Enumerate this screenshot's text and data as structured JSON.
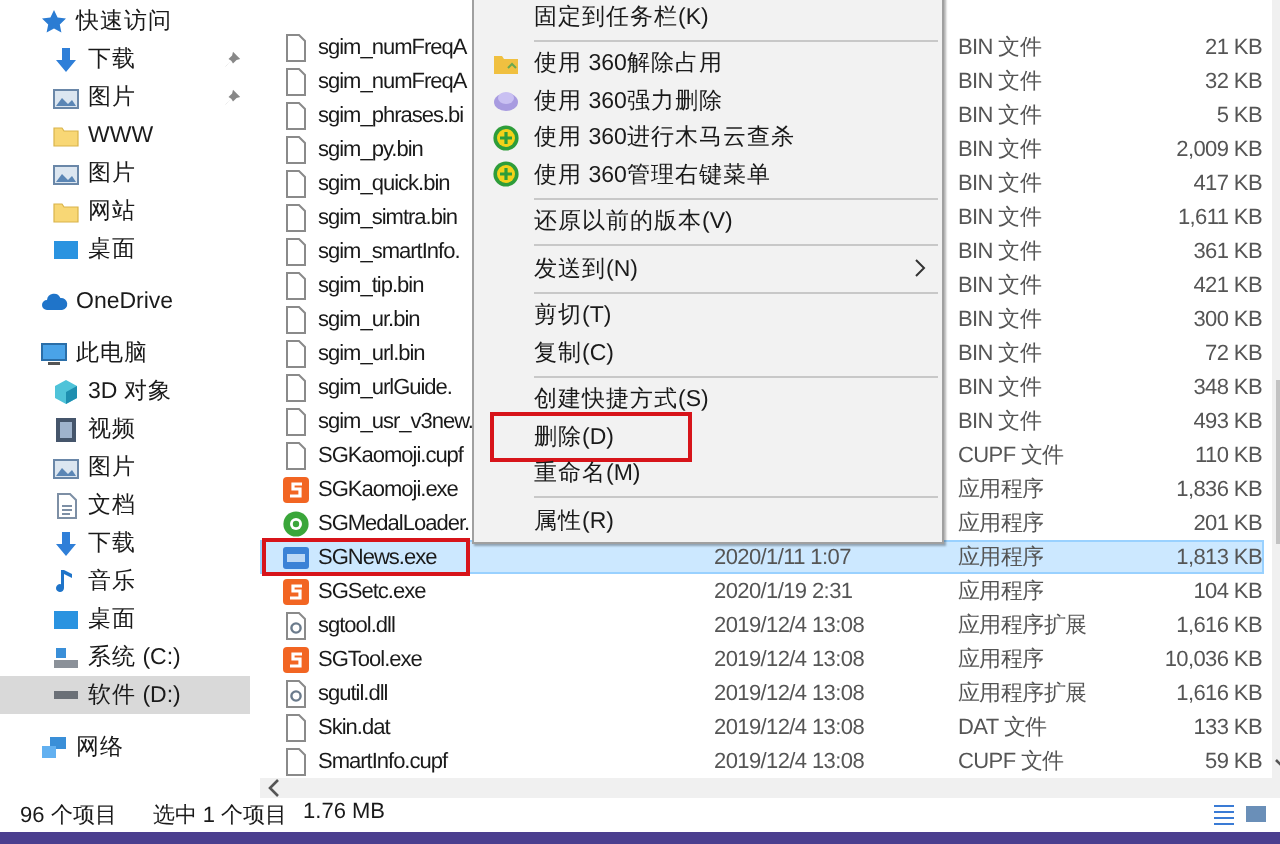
{
  "sidebar": {
    "items": [
      {
        "label": "快速访问",
        "kind": "star",
        "selected": false,
        "children": [
          {
            "label": "下载",
            "kind": "download",
            "pinned": true,
            "selected": false
          },
          {
            "label": "图片",
            "kind": "pictures",
            "pinned": true,
            "selected": false
          },
          {
            "label": "WWW",
            "kind": "folder",
            "pinned": false,
            "selected": false
          },
          {
            "label": "图片",
            "kind": "pictures",
            "pinned": false,
            "selected": false
          },
          {
            "label": "网站",
            "kind": "folder",
            "pinned": false,
            "selected": false
          },
          {
            "label": "桌面",
            "kind": "desktop",
            "pinned": false,
            "selected": false
          }
        ]
      },
      {
        "label": "OneDrive",
        "kind": "cloud",
        "selected": false
      },
      {
        "label": "此电脑",
        "kind": "computer",
        "selected": false,
        "children": [
          {
            "label": "3D 对象",
            "kind": "cube",
            "selected": false
          },
          {
            "label": "视频",
            "kind": "video",
            "selected": false
          },
          {
            "label": "图片",
            "kind": "pictures",
            "selected": false
          },
          {
            "label": "文档",
            "kind": "document",
            "selected": false
          },
          {
            "label": "下载",
            "kind": "download",
            "selected": false
          },
          {
            "label": "音乐",
            "kind": "music",
            "selected": false
          },
          {
            "label": "桌面",
            "kind": "desktop",
            "selected": false
          },
          {
            "label": "系统 (C:)",
            "kind": "system-drive",
            "selected": false
          },
          {
            "label": "软件 (D:)",
            "kind": "drive",
            "selected": true
          }
        ]
      },
      {
        "label": "网络",
        "kind": "network",
        "selected": false
      }
    ]
  },
  "file_list": {
    "rows": [
      {
        "name": "sgim_numFreqA",
        "kind": "file",
        "type": "BIN 文件",
        "size": "21 KB",
        "selected": false,
        "highlighted": false
      },
      {
        "name": "sgim_numFreqA",
        "kind": "file",
        "type": "BIN 文件",
        "size": "32 KB",
        "selected": false,
        "highlighted": false
      },
      {
        "name": "sgim_phrases.bi",
        "kind": "file",
        "type": "BIN 文件",
        "size": "5 KB",
        "selected": false,
        "highlighted": false
      },
      {
        "name": "sgim_py.bin",
        "kind": "file",
        "type": "BIN 文件",
        "size": "2,009 KB",
        "selected": false,
        "highlighted": false
      },
      {
        "name": "sgim_quick.bin",
        "kind": "file",
        "type": "BIN 文件",
        "size": "417 KB",
        "selected": false,
        "highlighted": false
      },
      {
        "name": "sgim_simtra.bin",
        "kind": "file",
        "type": "BIN 文件",
        "size": "1,611 KB",
        "selected": false,
        "highlighted": false
      },
      {
        "name": "sgim_smartInfo.",
        "kind": "file",
        "type": "BIN 文件",
        "size": "361 KB",
        "selected": false,
        "highlighted": false
      },
      {
        "name": "sgim_tip.bin",
        "kind": "file",
        "type": "BIN 文件",
        "size": "421 KB",
        "selected": false,
        "highlighted": false
      },
      {
        "name": "sgim_ur.bin",
        "kind": "file",
        "type": "BIN 文件",
        "size": "300 KB",
        "selected": false,
        "highlighted": false
      },
      {
        "name": "sgim_url.bin",
        "kind": "file",
        "type": "BIN 文件",
        "size": "72 KB",
        "selected": false,
        "highlighted": false
      },
      {
        "name": "sgim_urlGuide.",
        "kind": "file",
        "type": "BIN 文件",
        "size": "348 KB",
        "selected": false,
        "highlighted": false
      },
      {
        "name": "sgim_usr_v3new.",
        "kind": "file",
        "type": "BIN 文件",
        "size": "493 KB",
        "selected": false,
        "highlighted": false
      },
      {
        "name": "SGKaomoji.cupf",
        "kind": "file",
        "type": "CUPF 文件",
        "size": "110 KB",
        "selected": false,
        "highlighted": false
      },
      {
        "name": "SGKaomoji.exe",
        "kind": "sogou",
        "type": "应用程序",
        "size": "1,836 KB",
        "selected": false,
        "highlighted": false
      },
      {
        "name": "SGMedalLoader.",
        "kind": "medal",
        "type": "应用程序",
        "size": "201 KB",
        "selected": false,
        "highlighted": false
      },
      {
        "name": "SGNews.exe",
        "kind": "news",
        "date": "2020/1/11 1:07",
        "type": "应用程序",
        "size": "1,813 KB",
        "selected": true,
        "highlighted": true
      },
      {
        "name": "SGSetc.exe",
        "kind": "sogou",
        "date": "2020/1/19 2:31",
        "type": "应用程序",
        "size": "104 KB",
        "selected": false,
        "highlighted": false
      },
      {
        "name": "sgtool.dll",
        "kind": "dll",
        "date": "2019/12/4 13:08",
        "type": "应用程序扩展",
        "size": "1,616 KB",
        "selected": false,
        "highlighted": false
      },
      {
        "name": "SGTool.exe",
        "kind": "sogou",
        "date": "2019/12/4 13:08",
        "type": "应用程序",
        "size": "10,036 KB",
        "selected": false,
        "highlighted": false
      },
      {
        "name": "sgutil.dll",
        "kind": "dll",
        "date": "2019/12/4 13:08",
        "type": "应用程序扩展",
        "size": "1,616 KB",
        "selected": false,
        "highlighted": false
      },
      {
        "name": "Skin.dat",
        "kind": "file",
        "date": "2019/12/4 13:08",
        "type": "DAT 文件",
        "size": "133 KB",
        "selected": false,
        "highlighted": false
      },
      {
        "name": "SmartInfo.cupf",
        "kind": "file",
        "date": "2019/12/4 13:08",
        "type": "CUPF 文件",
        "size": "59 KB",
        "selected": false,
        "highlighted": false
      }
    ]
  },
  "context_menu": {
    "groups": [
      [
        {
          "label": "固定到任务栏(K)",
          "kind": "plain",
          "submenu": false,
          "highlighted": false
        }
      ],
      [
        {
          "label": "使用 360解除占用",
          "kind": "unlock",
          "submenu": false,
          "highlighted": false
        },
        {
          "label": "使用 360强力删除",
          "kind": "shred",
          "submenu": false,
          "highlighted": false
        },
        {
          "label": "使用 360进行木马云查杀",
          "kind": "scan",
          "submenu": false,
          "highlighted": false
        },
        {
          "label": "使用 360管理右键菜单",
          "kind": "scan",
          "submenu": false,
          "highlighted": false
        }
      ],
      [
        {
          "label": "还原以前的版本(V)",
          "kind": "plain",
          "submenu": false,
          "highlighted": false
        }
      ],
      [
        {
          "label": "发送到(N)",
          "kind": "plain",
          "submenu": true,
          "highlighted": false
        }
      ],
      [
        {
          "label": "剪切(T)",
          "kind": "plain",
          "submenu": false,
          "highlighted": false
        },
        {
          "label": "复制(C)",
          "kind": "plain",
          "submenu": false,
          "highlighted": false
        }
      ],
      [
        {
          "label": "创建快捷方式(S)",
          "kind": "plain",
          "submenu": false,
          "highlighted": false
        },
        {
          "label": "删除(D)",
          "kind": "plain",
          "submenu": false,
          "highlighted": true
        },
        {
          "label": "重命名(M)",
          "kind": "plain",
          "submenu": false,
          "highlighted": false
        }
      ],
      [
        {
          "label": "属性(R)",
          "kind": "plain",
          "submenu": false,
          "highlighted": false
        }
      ]
    ]
  },
  "status_bar": {
    "item_count": "96 个项目",
    "selection": "选中 1 个项目",
    "selection_size": "1.76 MB"
  }
}
